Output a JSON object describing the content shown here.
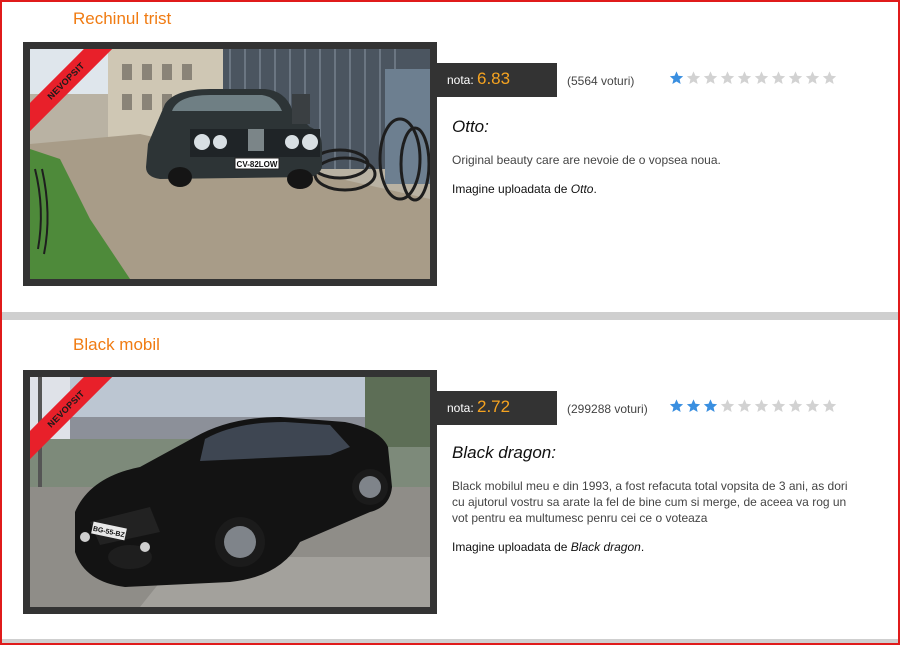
{
  "entries": [
    {
      "title": "Rechinul trist",
      "badge": "NEVOPSIT",
      "nota_label": "nota:",
      "nota_value": "6.83",
      "votes": "(5564 voturi)",
      "rating_filled": 1,
      "rating_total": 10,
      "author_heading": "Otto:",
      "description": "Original beauty care are nevoie de o vopsea noua.",
      "upload_prefix": "Imagine uploadata de",
      "upload_author": "Otto",
      "upload_suffix": ".",
      "plate": "CV-82LOW"
    },
    {
      "title": "Black mobil",
      "badge": "NEVOPSIT",
      "nota_label": "nota:",
      "nota_value": "2.72",
      "votes": "(299288 voturi)",
      "rating_filled": 3,
      "rating_total": 10,
      "author_heading": "Black dragon:",
      "description": "Black mobilul meu e din 1993, a fost refacuta total vopsita de 3 ani, as dori cu ajutorul vostru sa arate la fel de bine cum si merge, de aceea va rog un vot pentru ea multumesc penru cei ce o voteaza",
      "upload_prefix": "Imagine uploadata de",
      "upload_author": "Black dragon",
      "upload_suffix": ".",
      "plate": "BG-55-BZ"
    }
  ],
  "colors": {
    "title": "#f07b12",
    "nota_value": "#f5a320",
    "star_filled": "#3a8fe0",
    "star_empty": "#d2d2d2",
    "ribbon": "#e8202a",
    "frame": "#e01b1b"
  },
  "icons": {
    "star": "star-icon"
  }
}
